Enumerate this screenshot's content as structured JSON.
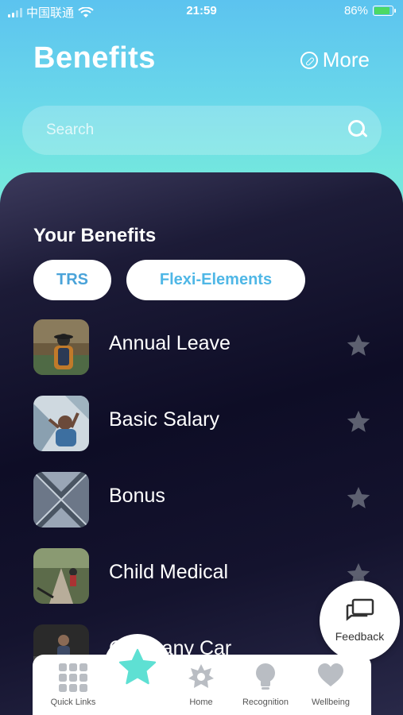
{
  "status_bar": {
    "carrier": "中国联通",
    "time": "21:59",
    "battery": "86%",
    "battery_level": 0.86
  },
  "header": {
    "title": "Benefits",
    "more_label": "More"
  },
  "search": {
    "placeholder": "Search"
  },
  "benefits": {
    "heading": "Your Benefits",
    "filters": [
      "TRS",
      "Flexi-Elements"
    ],
    "items": [
      {
        "label": "Annual Leave"
      },
      {
        "label": "Basic Salary"
      },
      {
        "label": "Bonus"
      },
      {
        "label": "Child Medical"
      },
      {
        "label": "Company Car"
      }
    ]
  },
  "feedback": {
    "label": "Feedback"
  },
  "bottom_nav": {
    "items": [
      {
        "label": "Quick Links"
      },
      {
        "label": "Home"
      },
      {
        "label": "Recognition"
      },
      {
        "label": "Wellbeing"
      }
    ]
  },
  "colors": {
    "accent": "#4fb7e6",
    "fab_star": "#5ee0d3",
    "nav_icon": "#b9bdc3",
    "star_inactive": "#5d6070"
  }
}
